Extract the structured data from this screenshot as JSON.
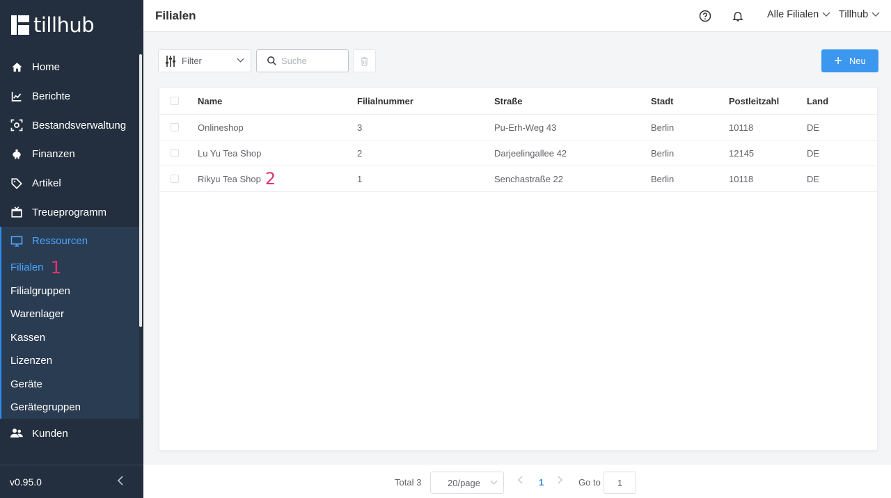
{
  "brand": {
    "name": "tillhub"
  },
  "sidebar": {
    "items": [
      {
        "label": "Home",
        "icon": "home-icon"
      },
      {
        "label": "Berichte",
        "icon": "chart-icon"
      },
      {
        "label": "Bestandsverwaltung",
        "icon": "inventory-icon"
      },
      {
        "label": "Finanzen",
        "icon": "piggy-bank-icon"
      },
      {
        "label": "Artikel",
        "icon": "tag-icon"
      },
      {
        "label": "Treueprogramm",
        "icon": "gift-icon"
      }
    ],
    "active_group": {
      "label": "Ressourcen",
      "icon": "monitor-icon",
      "children": [
        "Filialen",
        "Filialgruppen",
        "Warenlager",
        "Kassen",
        "Lizenzen",
        "Geräte",
        "Gerätegruppen"
      ]
    },
    "after": [
      {
        "label": "Kunden",
        "icon": "users-icon"
      }
    ],
    "annotation_1": "1",
    "version": "v0.95.0",
    "colors": {
      "bg": "#232f3e",
      "active": "#4aa3ff",
      "annotation": "#e2336f"
    }
  },
  "header": {
    "title": "Filialen",
    "branch_selector": "Alle Filialen",
    "account_menu": "Tillhub"
  },
  "toolbar": {
    "filter_label": "Filter",
    "search_placeholder": "Suche",
    "new_label": "Neu",
    "accent": "#3c97ef"
  },
  "table": {
    "columns": [
      "Name",
      "Filialnummer",
      "Straße",
      "Stadt",
      "Postleitzahl",
      "Land"
    ],
    "rows": [
      [
        "Onlineshop",
        "3",
        "Pu-Erh-Weg 43",
        "Berlin",
        "10118",
        "DE"
      ],
      [
        "Lu Yu Tea Shop",
        "2",
        "Darjeelingallee 42",
        "Berlin",
        "12145",
        "DE"
      ],
      [
        "Rikyu Tea Shop",
        "1",
        "Senchastraße 22",
        "Berlin",
        "10118",
        "DE"
      ]
    ],
    "annotation_2": "2"
  },
  "pagination": {
    "total": "Total 3",
    "page_size": "20/page",
    "current_page": "1",
    "goto_label": "Go to",
    "goto_value": "1"
  }
}
